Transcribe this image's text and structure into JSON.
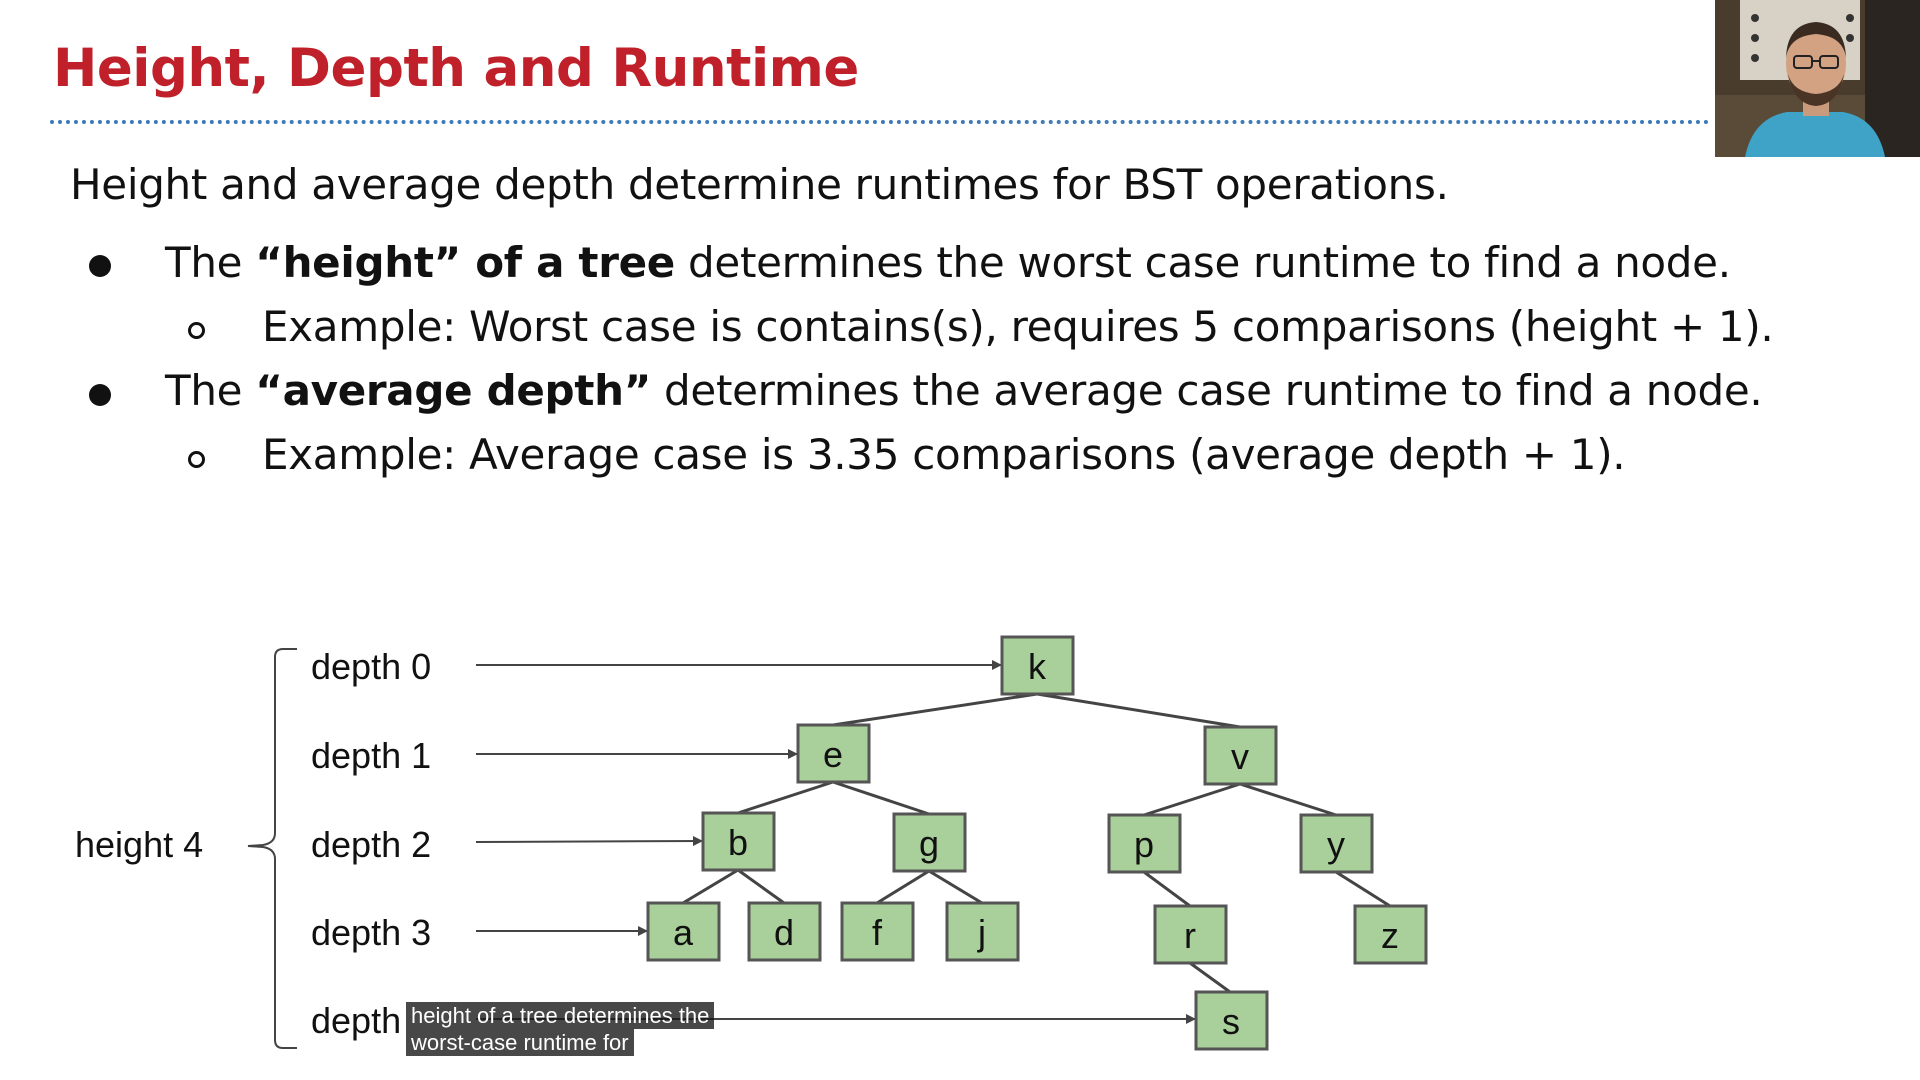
{
  "slide": {
    "title": "Height, Depth and Runtime",
    "intro": "Height and average depth determine runtimes for BST operations.",
    "bullets": [
      {
        "pre": "The ",
        "bold": "“height” of a tree",
        "post": " determines the worst case runtime to find a node.",
        "sub": "Example: Worst case is contains(s), requires 5 comparisons (height + 1)."
      },
      {
        "pre": "The ",
        "bold": "“average depth”",
        "post": " determines the average case runtime to find a node.",
        "sub": "Example: Average case is 3.35 comparisons (average depth + 1)."
      }
    ]
  },
  "diagram": {
    "height_label": "height 4",
    "depth_labels": [
      "depth 0",
      "depth 1",
      "depth 2",
      "depth 3",
      "depth"
    ],
    "nodes": {
      "k": "k",
      "e": "e",
      "v": "v",
      "b": "b",
      "g": "g",
      "p": "p",
      "y": "y",
      "a": "a",
      "d": "d",
      "f": "f",
      "j": "j",
      "r": "r",
      "z": "z",
      "s": "s"
    },
    "node_fill": "#a9cf9b",
    "node_stroke": "#555555"
  },
  "caption": {
    "line1": "height of a tree determines the",
    "line2": "worst-case runtime for"
  },
  "colors": {
    "title": "#c0202a",
    "divider": "#3d7ab8"
  },
  "webcam": {
    "icon": "presenter-webcam"
  }
}
